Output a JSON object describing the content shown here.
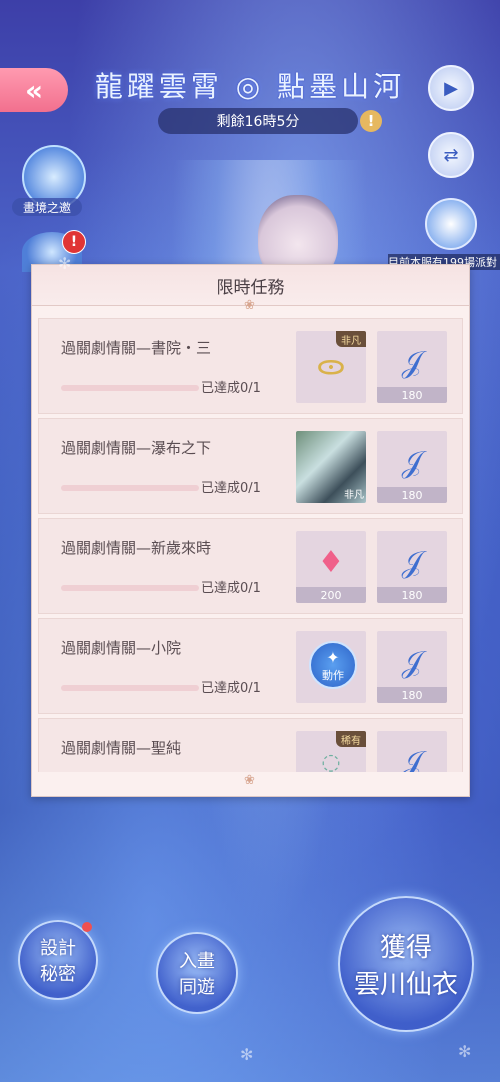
{
  "header": {
    "event_title": "龍躍雲霄 ◎ 點墨山河",
    "timer": "剩餘16時5分",
    "timer_alert": "!"
  },
  "left_sidebar": {
    "back_icon": "double-chevron-left-icon",
    "item1_label": "畫境之邀",
    "alert": "!"
  },
  "right_sidebar": {
    "play_icon": "play-icon",
    "switch_icon": "swap-arrows-icon",
    "photo_label": "目前本服有199場派對"
  },
  "panel": {
    "title": "限時任務",
    "tasks": [
      {
        "name": "過關劇情關—書院・三",
        "progress_text": "已達成0/1",
        "progress": 0,
        "rewards": [
          {
            "icon": "necklace-icon",
            "count": "",
            "tag": "非凡"
          },
          {
            "icon": "blue-hook-icon",
            "count": "180",
            "tag": ""
          }
        ]
      },
      {
        "name": "過關劇情關—瀑布之下",
        "progress_text": "已達成0/1",
        "progress": 0,
        "rewards": [
          {
            "icon": "scene-card-icon",
            "count": "",
            "tag": "非凡"
          },
          {
            "icon": "blue-hook-icon",
            "count": "180",
            "tag": ""
          }
        ]
      },
      {
        "name": "過關劇情關—新歲來時",
        "progress_text": "已達成0/1",
        "progress": 0,
        "rewards": [
          {
            "icon": "pink-diamond-icon",
            "count": "200",
            "tag": ""
          },
          {
            "icon": "blue-hook-icon",
            "count": "180",
            "tag": ""
          }
        ]
      },
      {
        "name": "過關劇情關—小院",
        "progress_text": "已達成0/1",
        "progress": 0,
        "rewards": [
          {
            "icon": "action-badge-icon",
            "count": "",
            "tag": "",
            "label": "動作"
          },
          {
            "icon": "blue-hook-icon",
            "count": "180",
            "tag": ""
          }
        ]
      },
      {
        "name": "過關劇情關—聖純",
        "progress_text": "",
        "progress": 0,
        "rewards": [
          {
            "icon": "bead-bracelet-icon",
            "count": "",
            "tag": "稀有"
          },
          {
            "icon": "blue-hook-icon",
            "count": "",
            "tag": ""
          }
        ]
      }
    ]
  },
  "bottom": {
    "design_secret": "設計\n秘密",
    "enter_painting": "入畫\n同遊",
    "obtain_outfit": "獲得\n雲川仙衣"
  }
}
